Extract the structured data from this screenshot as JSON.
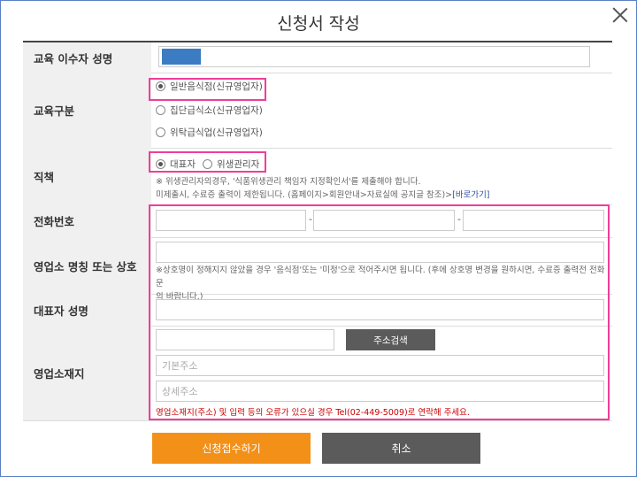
{
  "dialog": {
    "title": "신청서 작성",
    "close_label": ""
  },
  "rows": {
    "name": {
      "label": "교육 이수자 성명"
    },
    "edu_type": {
      "label": "교육구분",
      "options": [
        "일반음식점(신규영업자)",
        "집단급식소(신규영업자)",
        "위탁급식업(신규영업자)"
      ],
      "selected": 0
    },
    "role": {
      "label": "직책",
      "options": [
        "대표자",
        "위생관리자"
      ],
      "selected": 0,
      "note_line1": "※ 위생관리자의경우, '식품위생관리 책임자 지정확인서'를 제출해야 합니다.",
      "note_line2": "미제출시, 수료증 출력이 제한됩니다. (홈페이지>회원안내>자료실에 공지글 참조)>",
      "note_link": "[바로가기]"
    },
    "phone": {
      "label": "전화번호",
      "sep": "-"
    },
    "biz_name": {
      "label": "영업소 명칭 또는 상호",
      "note_line1": "※상호명이 정해지지 않았을 경우 '음식점'또는 '미정'으로 적어주시면 됩니다. (후에 상호명 변경을 원하시면, 수료증 출력전 전화문",
      "note_line2": "의 바랍니다.)"
    },
    "ceo_name": {
      "label": "대표자 성명"
    },
    "address": {
      "label": "영업소재지",
      "search_button": "주소검색",
      "basic_placeholder": "기본주소",
      "detail_placeholder": "상세주소",
      "warning": "영업소재지(주소) 및 입력 등의 오류가 있으실 경우 Tel(02-449-5009)로 연락해 주세요."
    }
  },
  "buttons": {
    "submit": "신청접수하기",
    "cancel": "취소"
  },
  "colors": {
    "highlight": "#ee3e9a",
    "primary": "#f39018",
    "secondary": "#5b5b5b",
    "name_fill": "#3b7cc2"
  }
}
